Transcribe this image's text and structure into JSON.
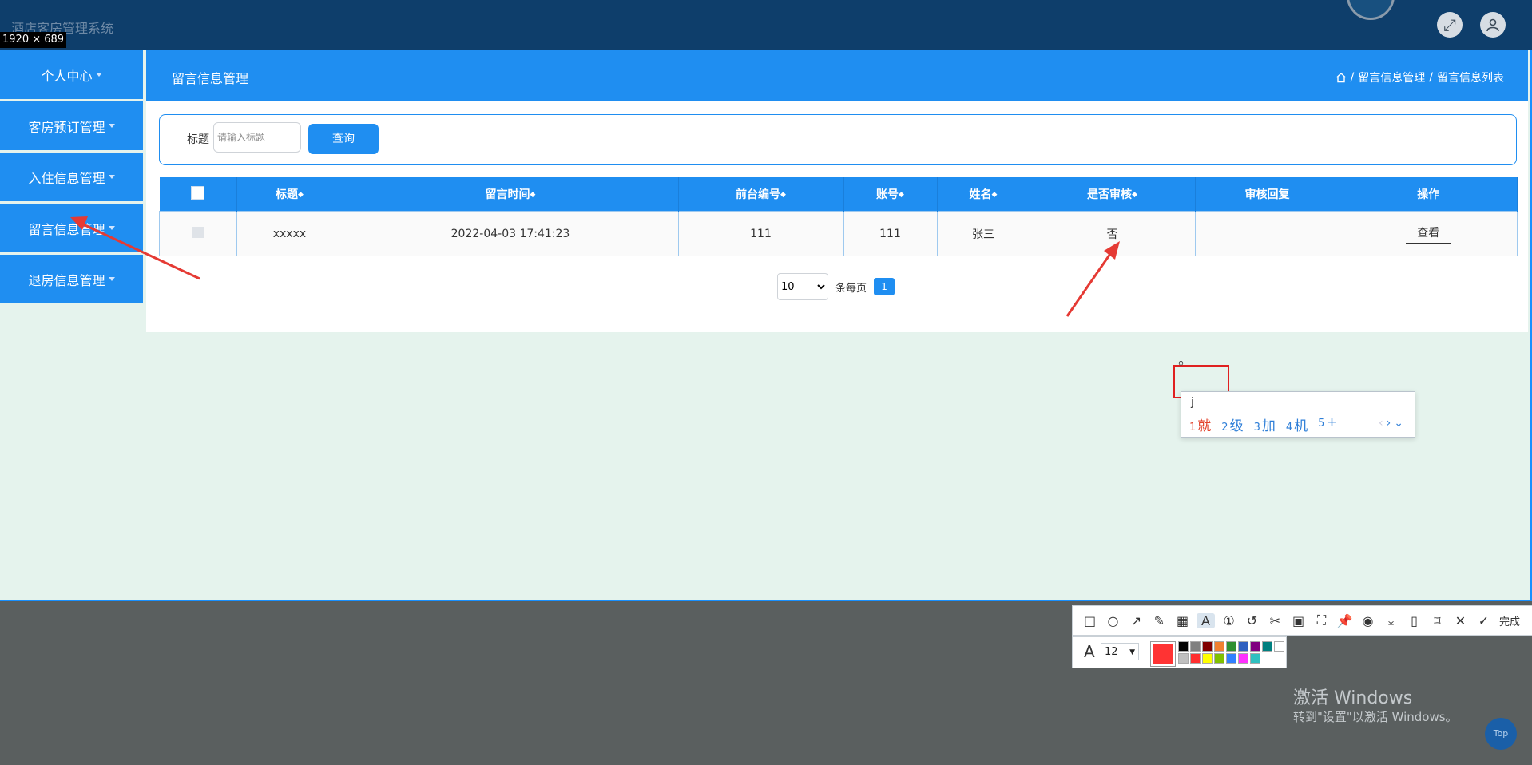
{
  "app": {
    "title": "酒店客房管理系统",
    "size_label": "1920 × 689"
  },
  "topbar": {
    "fullscreen_icon": "fullscreen-icon",
    "user_icon": "user-icon"
  },
  "sidebar": {
    "items": [
      {
        "label": "个人中心"
      },
      {
        "label": "客房预订管理"
      },
      {
        "label": "入住信息管理"
      },
      {
        "label": "留言信息管理"
      },
      {
        "label": "退房信息管理"
      }
    ]
  },
  "page": {
    "title": "留言信息管理",
    "breadcrumb": {
      "sep": "/",
      "items": [
        "留言信息管理",
        "留言信息列表"
      ]
    }
  },
  "search": {
    "label": "标题",
    "placeholder": "请输入标题",
    "button": "查询"
  },
  "table": {
    "columns": [
      "标题",
      "留言时间",
      "前台编号",
      "账号",
      "姓名",
      "是否审核",
      "审核回复",
      "操作"
    ],
    "rows": [
      {
        "title": "xxxxx",
        "time": "2022-04-03 17:41:23",
        "desk_no": "111",
        "account": "111",
        "name": "张三",
        "reviewed": "否",
        "reply": "",
        "action": "查看"
      }
    ]
  },
  "pagination": {
    "page_size": "10",
    "per_page_label": "条每页",
    "current_page": "1"
  },
  "ime": {
    "input": "j",
    "candidates": [
      {
        "num": "1",
        "text": "就"
      },
      {
        "num": "2",
        "text": "级"
      },
      {
        "num": "3",
        "text": "加"
      },
      {
        "num": "4",
        "text": "机"
      },
      {
        "num": "5",
        "text": "+"
      }
    ]
  },
  "screenshot_toolbar": {
    "done_label": "完成",
    "font_size": "12"
  },
  "palette": [
    "#000000",
    "#808080",
    "#800000",
    "#f08030",
    "#2f8f2f",
    "#3060c0",
    "#800080",
    "#008080",
    "#ffffff",
    "#c0c0c0",
    "#ff3030",
    "#ffff00",
    "#80c000",
    "#3080ff",
    "#ff30ff",
    "#30c0c0"
  ],
  "windows": {
    "line1": "激活 Windows",
    "line2": "转到\"设置\"以激活 Windows。"
  },
  "top_button": "Top"
}
